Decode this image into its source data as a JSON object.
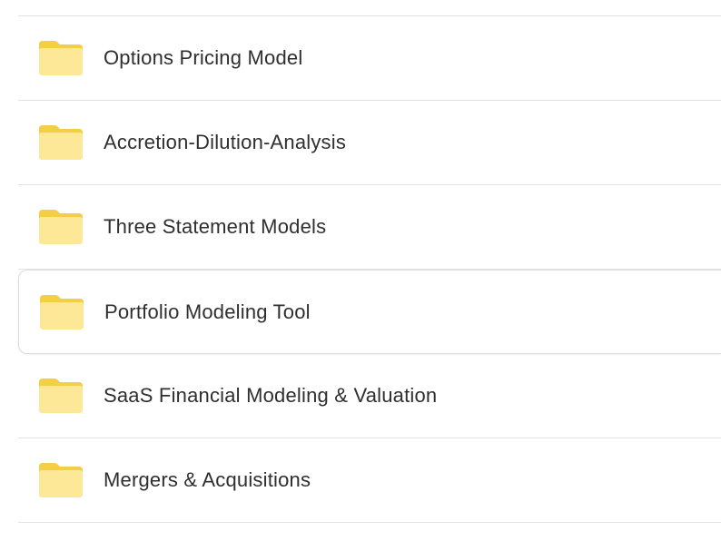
{
  "folders": [
    {
      "name": "Options Pricing Model",
      "icon": "folder-icon"
    },
    {
      "name": "Accretion-Dilution-Analysis",
      "icon": "folder-icon"
    },
    {
      "name": "Three Statement Models",
      "icon": "folder-icon"
    },
    {
      "name": "Portfolio Modeling Tool",
      "icon": "folder-icon",
      "hovered": true
    },
    {
      "name": "SaaS Financial Modeling & Valuation",
      "icon": "folder-icon"
    },
    {
      "name": "Mergers & Acquisitions",
      "icon": "folder-icon"
    }
  ],
  "colors": {
    "folder_back": "#f4cf45",
    "folder_front": "#fde897",
    "text": "#2f2f2f",
    "divider": "#e3e3e3"
  }
}
